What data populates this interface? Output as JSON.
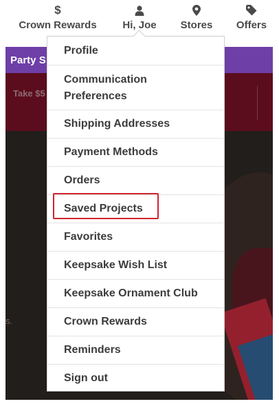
{
  "nav": {
    "rewards": {
      "label": "Crown Rewards",
      "icon": "dollar-icon",
      "glyph": "$"
    },
    "account": {
      "label": "Hi, Joe",
      "icon": "user-icon"
    },
    "stores": {
      "label": "Stores",
      "icon": "map-pin-icon"
    },
    "offers": {
      "label": "Offers",
      "icon": "tag-icon"
    }
  },
  "promo_bar": {
    "text": "Party S"
  },
  "banner": {
    "text": "Take $5"
  },
  "hero": {
    "edge_text": "s."
  },
  "account_menu": {
    "items": [
      {
        "label": "Profile"
      },
      {
        "label": "Communication Preferences"
      },
      {
        "label": "Shipping Addresses"
      },
      {
        "label": "Payment Methods"
      },
      {
        "label": "Orders"
      },
      {
        "label": "Saved Projects"
      },
      {
        "label": "Favorites"
      },
      {
        "label": "Keepsake Wish List"
      },
      {
        "label": "Keepsake Ornament Club"
      },
      {
        "label": "Crown Rewards"
      },
      {
        "label": "Reminders"
      },
      {
        "label": "Sign out"
      }
    ]
  },
  "colors": {
    "promo_purple": "#6e3fa7",
    "banner_maroon": "#5b0d1d",
    "highlight_red": "#d0232f"
  }
}
